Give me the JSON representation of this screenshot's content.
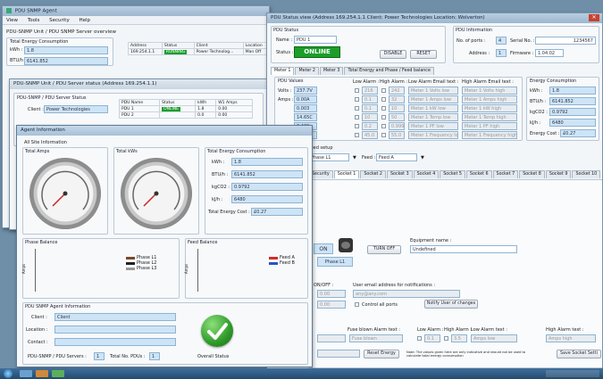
{
  "main_window": {
    "title": "PDU SNMP Agent",
    "menu": [
      "View",
      "Tools",
      "Security",
      "Help"
    ],
    "breadcrumb": "PDU-SNMP Unit / PDU SNMP Server overview",
    "energy_group_title": "Total Energy Consumption",
    "kwh_label": "kWh :",
    "kwh_value": "1.8",
    "btuh_label": "BTU/h :",
    "btuh_value": "6141.852",
    "table_headers": [
      "Address",
      "Status",
      "Client",
      "Location"
    ],
    "table_row": [
      "169.254.1.1",
      "RUNNING",
      "Power Technolog...",
      "Man Off"
    ]
  },
  "server_status_window": {
    "title": "PDU-SNMP Unit / PDU Server status (Address 169.254.1.1)",
    "group_title": "PDU-SNMP / PDU Server Status",
    "client_label": "Client :",
    "client_value": "Power Technologies",
    "columns": [
      "PDU Name",
      "Status",
      "kWh",
      "W1 Amps"
    ],
    "rows": [
      [
        "PDU 1",
        "ONLINE",
        "1.8",
        "0.00"
      ],
      [
        "PDU 2",
        "",
        "0.0",
        "0.00"
      ]
    ]
  },
  "pdu_status_window": {
    "title": "PDU Status view (Address 169.254.1.1  Client: Power Technologies  Location: Wolverton)",
    "pdu_group": "PDU Status",
    "name_label": "Name :",
    "name_value": "PDU 1",
    "status_label": "Status :",
    "status_value": "ONLINE",
    "disable_button": "DISABLE",
    "reset_button": "RESET",
    "info_group": "PDU Information",
    "ports_label": "No. of ports :",
    "ports_value": "4",
    "serial_label": "Serial No. :",
    "serial_value": "1234567",
    "address_label": "Address :",
    "address_value": "1",
    "firmware_label": "Firmware :",
    "firmware_value": "1.04.02",
    "meter_tabs": [
      "Meter 1",
      "Meter 2",
      "Meter 3",
      "Total Energy and Phase / Feed balance"
    ],
    "values_group": "PDU Values",
    "values_headers": [
      "Low Alarm :",
      "High Alarm :",
      "Low Alarm Email text :",
      "High Alarm Email text :"
    ],
    "values_rows": [
      {
        "label": "Volts :",
        "value": "237.7V",
        "low": "216",
        "high": "242",
        "low_text": "Meter 1 Volts low",
        "high_text": "Meter 1 Volts high"
      },
      {
        "label": "Amps :",
        "value": "0.00A",
        "low": "0.1",
        "high": "32",
        "low_text": "Meter 1 Amps low",
        "high_text": "Meter 1 Amps high"
      },
      {
        "label": "",
        "value": "0.003",
        "low": "0.1",
        "high": "10",
        "low_text": "Meter 1 kW low",
        "high_text": "Meter 1 kW high"
      },
      {
        "label": "",
        "value": "14.65C",
        "low": "10",
        "high": "50",
        "low_text": "Meter 1 Temp low",
        "high_text": "Meter 1 Temp high"
      },
      {
        "label": "",
        "value": "0.429",
        "low": "0.2",
        "high": "0.999",
        "low_text": "Meter 1 PF low",
        "high_text": "Meter 1 PF high"
      },
      {
        "label": "",
        "value": "50.0Hz",
        "low": "45.0",
        "high": "55.0",
        "low_text": "Meter 1 Frequency low",
        "high_text": "Meter 1 Frequency high"
      }
    ],
    "energy_group": "Energy Consumption",
    "energy_rows": [
      {
        "label": "kWh :",
        "value": "1.8"
      },
      {
        "label": "BTU/h :",
        "value": "6141.852"
      },
      {
        "label": "kgCO2 :",
        "value": "0.9792"
      },
      {
        "label": "kJ/h :",
        "value": "6480"
      },
      {
        "label": "Energy Cost :",
        "value": "£0.27"
      }
    ],
    "feed_setup_label": "Feed setup",
    "phase_value": "Phase L1",
    "feed_label": "Feed :",
    "feed_value": "Feed A",
    "socket_tabs": [
      "Security",
      "Socket 1",
      "Socket 2",
      "Socket 3",
      "Socket 4",
      "Socket 5",
      "Socket 6",
      "Socket 7",
      "Socket 8",
      "Socket 9",
      "Socket 10"
    ],
    "on_label": "ON",
    "turn_off_button": "TURN OFF",
    "phase_badge": "Phase L1",
    "equipment_label": "Equipment name :",
    "equipment_value": "Undefined",
    "on_off_label": "ON/OFF :",
    "on_off_value": "0.00",
    "email_label": "User email address for notifications :",
    "email_value": "any@any.com",
    "control_all_label": "Control all ports",
    "notify_button": "Notify User of changes",
    "fuse_label": "Fuse blown Alarm text :",
    "fuse_value": "Fuse blown",
    "sock_low_label": "Low Alarm :",
    "sock_low_value": "0.1",
    "sock_high_label": "High Alarm :",
    "sock_high_value": "3.5",
    "sock_low_text_label": "Low Alarm text :",
    "sock_low_text": "Amps low",
    "sock_high_text_label": "High Alarm text :",
    "sock_high_text": "Amps high",
    "reset_energy_button": "Reset Energy",
    "note": "Note: The values given here are only indicative and should not be used to calculate total energy consumption",
    "save_button": "Save Socket Setti"
  },
  "agent_window": {
    "title": "Agent Information",
    "all_site": "All Site Information",
    "total_amps": "Total Amps",
    "total_kw": "Total kWs",
    "tec_group": "Total Energy Consumption",
    "tec_rows": [
      {
        "label": "kWh :",
        "value": "1.8"
      },
      {
        "label": "BTU/h :",
        "value": "6141.852"
      },
      {
        "label": "kgCO2 :",
        "value": "0.9792"
      },
      {
        "label": "kJ/h :",
        "value": "6480"
      },
      {
        "label": "Total Energy Cost :",
        "value": "£0.27"
      }
    ],
    "phase_balance": "Phase Balance",
    "phase_axis": "Amps",
    "phase_legend": [
      {
        "name": "Phase L1",
        "color": "#7a4a26"
      },
      {
        "name": "Phase L2",
        "color": "#222222"
      },
      {
        "name": "Phase L3",
        "color": "#9a9a9a"
      }
    ],
    "feed_balance": "Feed Balance",
    "feed_axis": "Amps",
    "feed_legend": [
      {
        "name": "Feed A",
        "color": "#d42a2a"
      },
      {
        "name": "Feed B",
        "color": "#2a52c8"
      }
    ],
    "snmp_group": "PDU SNMP Agent Information",
    "client_label": "Client :",
    "client_value": "Client",
    "location_label": "Location :",
    "contact_label": "Contact :",
    "servers_label": "PDU-SNMP / PDU Servers :",
    "servers_value": "1",
    "total_pdus_label": "Total No. PDUs :",
    "total_pdus_value": "1",
    "overall_status": "Overall Status",
    "status_icon": "checkmark-icon"
  }
}
